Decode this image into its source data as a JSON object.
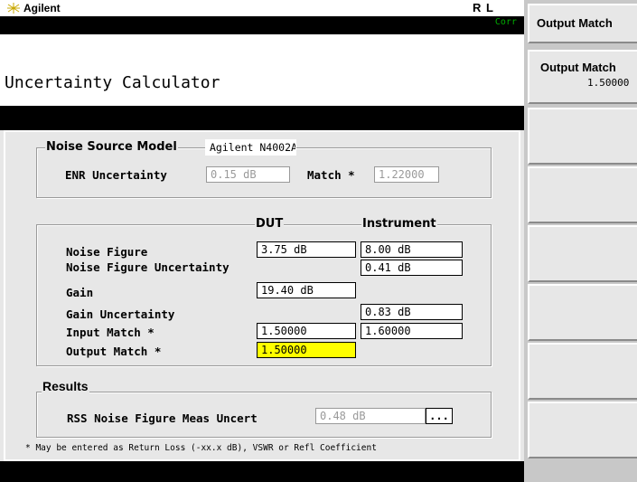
{
  "header": {
    "brand": "Agilent",
    "rl_indicator": "R L",
    "corr_indicator": "Corr",
    "page_title": "Uncertainty Calculator"
  },
  "noise_source_model": {
    "legend": "Noise Source Model",
    "model_value": "Agilent N4002A",
    "enr_uncertainty_label": "ENR Uncertainty",
    "enr_uncertainty_value": "0.15 dB",
    "match_label": "Match *",
    "match_value": "1.22000"
  },
  "measurements": {
    "dut_header": "DUT",
    "instrument_header": "Instrument",
    "rows": [
      {
        "label": "Noise Figure",
        "dut": "3.75 dB",
        "instrument": "8.00 dB"
      },
      {
        "label": "Noise Figure Uncertainty",
        "dut": "",
        "instrument": "0.41 dB"
      },
      {
        "label": "Gain",
        "dut": "19.40 dB",
        "instrument": ""
      },
      {
        "label": "Gain Uncertainty",
        "dut": "",
        "instrument": "0.83 dB"
      },
      {
        "label": "Input Match *",
        "dut": "1.50000",
        "instrument": "1.60000"
      },
      {
        "label": "Output Match *",
        "dut": "1.50000",
        "instrument": ""
      }
    ]
  },
  "results": {
    "legend": "Results",
    "rss_label": "RSS Noise Figure Meas Uncert",
    "rss_value": "0.48 dB",
    "rss_more": "..."
  },
  "footnote": "* May be entered as Return Loss (-xx.x dB), VSWR or Refl Coefficient",
  "softkeys": {
    "menu_title": "Output Match",
    "key1_label": "Output Match",
    "key1_value": "1.50000"
  },
  "colors": {
    "highlight": "#ffff00",
    "corr_text": "#00aa00"
  }
}
